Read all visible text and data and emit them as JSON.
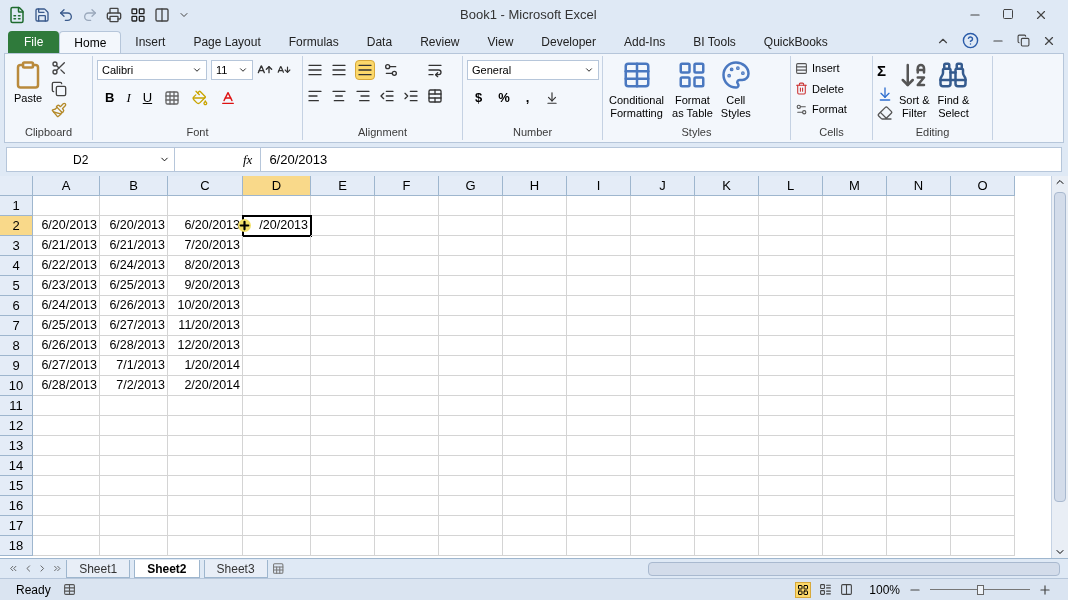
{
  "window": {
    "title": "Book1  -  Microsoft Excel"
  },
  "tabs": [
    {
      "label": "File",
      "selected": false,
      "kind": "file"
    },
    {
      "label": "Home",
      "selected": true,
      "kind": "tab"
    },
    {
      "label": "Insert",
      "selected": false,
      "kind": "tab"
    },
    {
      "label": "Page Layout",
      "selected": false,
      "kind": "tab"
    },
    {
      "label": "Formulas",
      "selected": false,
      "kind": "tab"
    },
    {
      "label": "Data",
      "selected": false,
      "kind": "tab"
    },
    {
      "label": "Review",
      "selected": false,
      "kind": "tab"
    },
    {
      "label": "View",
      "selected": false,
      "kind": "tab"
    },
    {
      "label": "Developer",
      "selected": false,
      "kind": "tab"
    },
    {
      "label": "Add-Ins",
      "selected": false,
      "kind": "tab"
    },
    {
      "label": "BI Tools",
      "selected": false,
      "kind": "tab"
    },
    {
      "label": "QuickBooks",
      "selected": false,
      "kind": "tab"
    }
  ],
  "ribbon": {
    "clipboard": {
      "label": "Clipboard",
      "paste": "Paste"
    },
    "font": {
      "label": "Font",
      "name": "Calibri",
      "size": "11",
      "styles": [
        "B",
        "I",
        "U"
      ]
    },
    "alignment": {
      "label": "Alignment",
      "bottom_align_selected": true
    },
    "number": {
      "label": "Number",
      "format": "General",
      "symbols": [
        "$",
        "%",
        ","
      ]
    },
    "styles": {
      "label": "Styles",
      "buttons": [
        [
          "Conditional",
          "Formatting"
        ],
        [
          "Format",
          "as Table"
        ],
        [
          "Cell",
          "Styles"
        ]
      ]
    },
    "cells": {
      "label": "Cells",
      "buttons": [
        "Insert",
        "Delete",
        "Format"
      ]
    },
    "editing": {
      "label": "Editing",
      "sigma": "Σ",
      "buttons": [
        [
          "Sort &",
          "Filter"
        ],
        [
          "Find &",
          "Select"
        ]
      ]
    }
  },
  "formula_bar": {
    "name_box": "D2",
    "fx": "fx",
    "value": "6/20/2013"
  },
  "grid": {
    "columns": [
      {
        "label": "A",
        "selected": false
      },
      {
        "label": "B",
        "selected": false
      },
      {
        "label": "C",
        "selected": false
      },
      {
        "label": "D",
        "selected": true
      },
      {
        "label": "E",
        "selected": false
      },
      {
        "label": "F",
        "selected": false
      },
      {
        "label": "G",
        "selected": false
      },
      {
        "label": "H",
        "selected": false
      },
      {
        "label": "I",
        "selected": false
      },
      {
        "label": "J",
        "selected": false
      },
      {
        "label": "K",
        "selected": false
      },
      {
        "label": "L",
        "selected": false
      },
      {
        "label": "M",
        "selected": false
      },
      {
        "label": "N",
        "selected": false
      },
      {
        "label": "O",
        "selected": false
      }
    ],
    "rows": [
      {
        "label": "1",
        "selected": false,
        "cells": []
      },
      {
        "label": "2",
        "selected": true,
        "cells": [
          "6/20/2013",
          "6/20/2013",
          "6/20/2013",
          "/20/2013"
        ]
      },
      {
        "label": "3",
        "selected": false,
        "cells": [
          "6/21/2013",
          "6/21/2013",
          "7/20/2013"
        ]
      },
      {
        "label": "4",
        "selected": false,
        "cells": [
          "6/22/2013",
          "6/24/2013",
          "8/20/2013"
        ]
      },
      {
        "label": "5",
        "selected": false,
        "cells": [
          "6/23/2013",
          "6/25/2013",
          "9/20/2013"
        ]
      },
      {
        "label": "6",
        "selected": false,
        "cells": [
          "6/24/2013",
          "6/26/2013",
          "10/20/2013"
        ]
      },
      {
        "label": "7",
        "selected": false,
        "cells": [
          "6/25/2013",
          "6/27/2013",
          "11/20/2013"
        ]
      },
      {
        "label": "8",
        "selected": false,
        "cells": [
          "6/26/2013",
          "6/28/2013",
          "12/20/2013"
        ]
      },
      {
        "label": "9",
        "selected": false,
        "cells": [
          "6/27/2013",
          "7/1/2013",
          "1/20/2014"
        ]
      },
      {
        "label": "10",
        "selected": false,
        "cells": [
          "6/28/2013",
          "7/2/2013",
          "2/20/2014"
        ]
      },
      {
        "label": "11",
        "selected": false,
        "cells": []
      },
      {
        "label": "12",
        "selected": false,
        "cells": []
      },
      {
        "label": "13",
        "selected": false,
        "cells": []
      },
      {
        "label": "14",
        "selected": false,
        "cells": []
      },
      {
        "label": "15",
        "selected": false,
        "cells": []
      },
      {
        "label": "16",
        "selected": false,
        "cells": []
      },
      {
        "label": "17",
        "selected": false,
        "cells": []
      },
      {
        "label": "18",
        "selected": false,
        "cells": []
      }
    ]
  },
  "sheets": [
    {
      "label": "Sheet1",
      "selected": false
    },
    {
      "label": "Sheet2",
      "selected": true
    },
    {
      "label": "Sheet3",
      "selected": false
    }
  ],
  "status_bar": {
    "status": "Ready",
    "zoom": "100%",
    "zoom_slider": {
      "level": 0.5
    }
  }
}
